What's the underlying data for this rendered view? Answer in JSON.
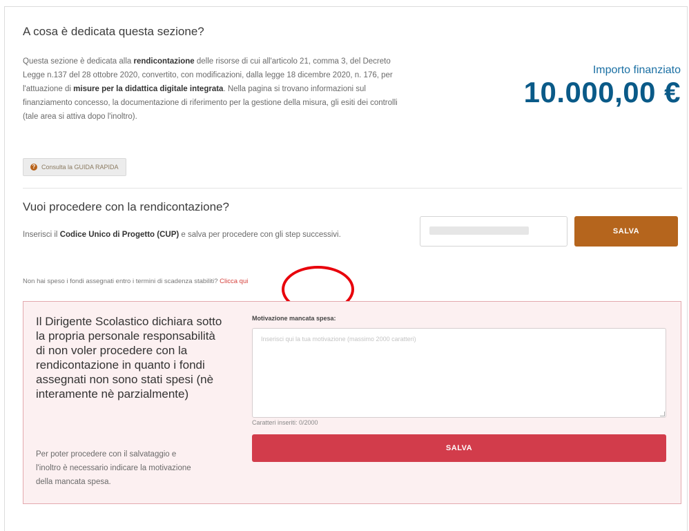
{
  "intro": {
    "title": "A cosa è dedicata questa sezione?",
    "p1": "Questa sezione è dedicata alla ",
    "b1": "rendicontazione",
    "p2": " delle risorse di cui all'articolo 21, comma 3, del Decreto Legge n.137 del 28 ottobre 2020, convertito, con modificazioni, dalla legge 18 dicembre 2020, n. 176, per l'attuazione di ",
    "b2": "misure per la didattica digitale integrata",
    "p3": ". Nella pagina si trovano informazioni sul finanziamento concesso, la documentazione di riferimento per la gestione della misura, gli esiti dei controlli (tale area si attiva dopo l'inoltro).",
    "guide_label": "Consulta la GUIDA RAPIDA",
    "guide_icon": "?"
  },
  "importo": {
    "label": "Importo finanziato",
    "value": "10.000,00 €"
  },
  "cup": {
    "title": "Vuoi procedere con la rendicontazione?",
    "t1": "Inserisci il ",
    "b1": "Codice Unico di Progetto (CUP)",
    "t2": " e salva per procedere con gli step successivi.",
    "save_label": "SALVA"
  },
  "not_spent": {
    "text": "Non hai speso i fondi assegnati entro i termini di scadenza stabiliti? ",
    "link": "Clicca qui"
  },
  "declaration": {
    "heading": "Il Dirigente Scolastico dichiara sotto la propria personale responsabilità di non voler procedere con la rendicontazione in quanto i fondi assegnati non sono stati spesi (nè interamente nè parzialmente)",
    "note": "Per poter procedere con il salvataggio e l'inoltro è necessario indicare la motivazione della mancata spesa.",
    "field_label": "Motivazione mancata spesa:",
    "placeholder": "Inserisci qui la tua motivazione (massimo 2000 caratteri)",
    "counter": "Caratteri inseriti: 0/2000",
    "save_label": "SALVA"
  },
  "colors": {
    "accent_blue": "#0a5a88",
    "save_brown": "#b5651d",
    "save_red": "#d23c4b",
    "panel_bg": "#fcf0f1",
    "annotation_circle": "#e8000b"
  }
}
